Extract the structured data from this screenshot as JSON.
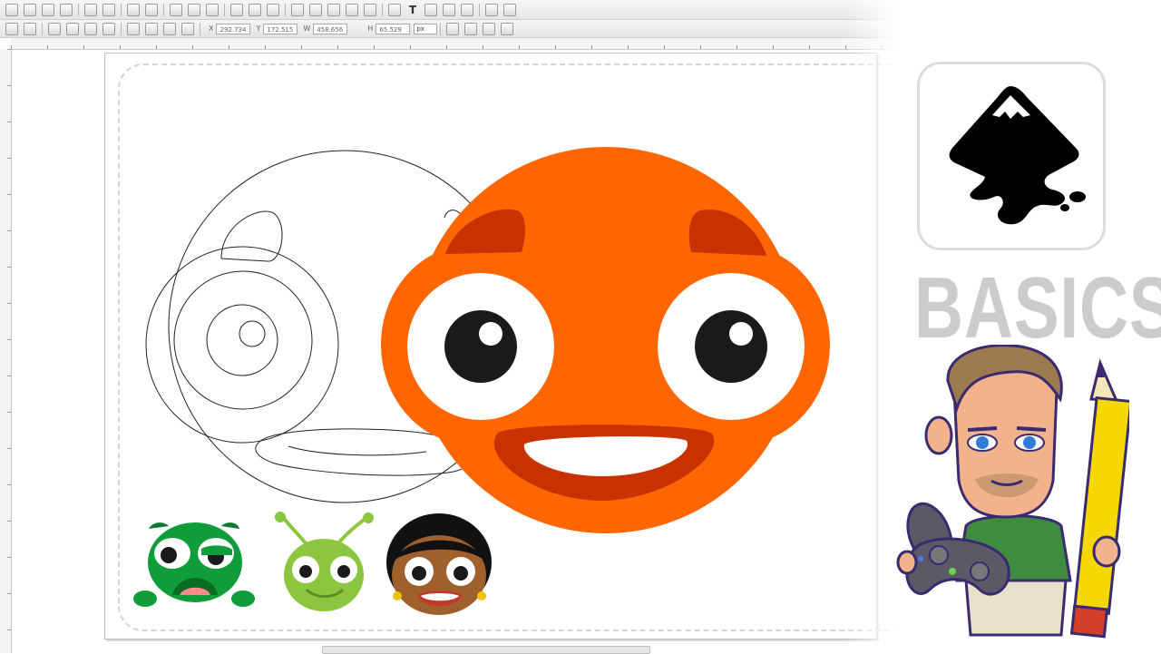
{
  "toolbar": {
    "icons": [
      "new-icon",
      "open-icon",
      "save-icon",
      "print-icon",
      "import-icon",
      "export-icon",
      "undo-icon",
      "redo-icon",
      "copy-icon",
      "cut-icon",
      "paste-icon",
      "zoom-in-icon",
      "zoom-out-icon",
      "zoom-fit-icon",
      "duplicate-icon",
      "clone-icon",
      "unlink-icon",
      "group-icon",
      "ungroup-icon",
      "fill-stroke-icon",
      "text-icon",
      "layers-icon",
      "xml-editor-icon",
      "align-icon",
      "preferences-icon",
      "document-properties-icon"
    ],
    "text_tool_glyph": "T"
  },
  "tool_controls": {
    "x_label": "X",
    "x_value": "292.734",
    "y_label": "Y",
    "y_value": "172.515",
    "w_label": "W",
    "w_value": "458.656",
    "h_label": "H",
    "h_value": "65.529",
    "unit": "px"
  },
  "brand": {
    "title": "BASICS"
  },
  "colors": {
    "orange": "#ff6600",
    "dark_orange": "#c83200",
    "eye_black": "#1a1a1a",
    "frog_green": "#0f9d3a",
    "bug_green": "#8cc63f",
    "skin_brown": "#a0602b",
    "title_gray": "#cccccc"
  }
}
